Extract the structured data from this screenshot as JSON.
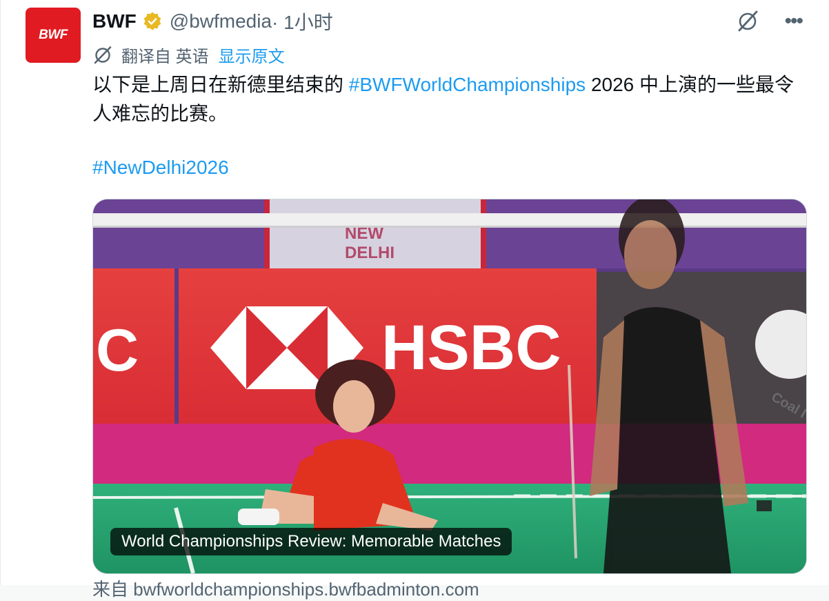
{
  "tweet": {
    "avatar_text": "BWF",
    "display_name": "BWF",
    "handle": "@bwfmedia",
    "time": " · 1小时",
    "translate_from": "翻译自 英语",
    "show_original": "显示原文",
    "body_prefix": "以下是上周日在新德里结束的 ",
    "body_hashtag": "#BWFWorldChampionships",
    "body_suffix": " 2026 中上演的一些最令人难忘的比赛。",
    "hashtag2": "#NewDelhi2026",
    "media_caption": "World Championships Review: Memorable Matches",
    "source_text": "来自 bwfworldchampionships.bwfbadminton.com"
  },
  "icons": {
    "verified": "verified-badge-icon",
    "grok": "grok-icon",
    "more": "more-icon",
    "translate": "translate-icon"
  },
  "photo_text": {
    "sponsor": "HSBC",
    "sponsor_left": "C",
    "venue_line1": "NEW",
    "venue_line2": "DELHI",
    "coal_logo": "Coal I"
  },
  "colors": {
    "link": "#1d9bf0",
    "secondary": "#536471",
    "brand_red": "#e11b22",
    "verified_gold": "#e8b923"
  }
}
